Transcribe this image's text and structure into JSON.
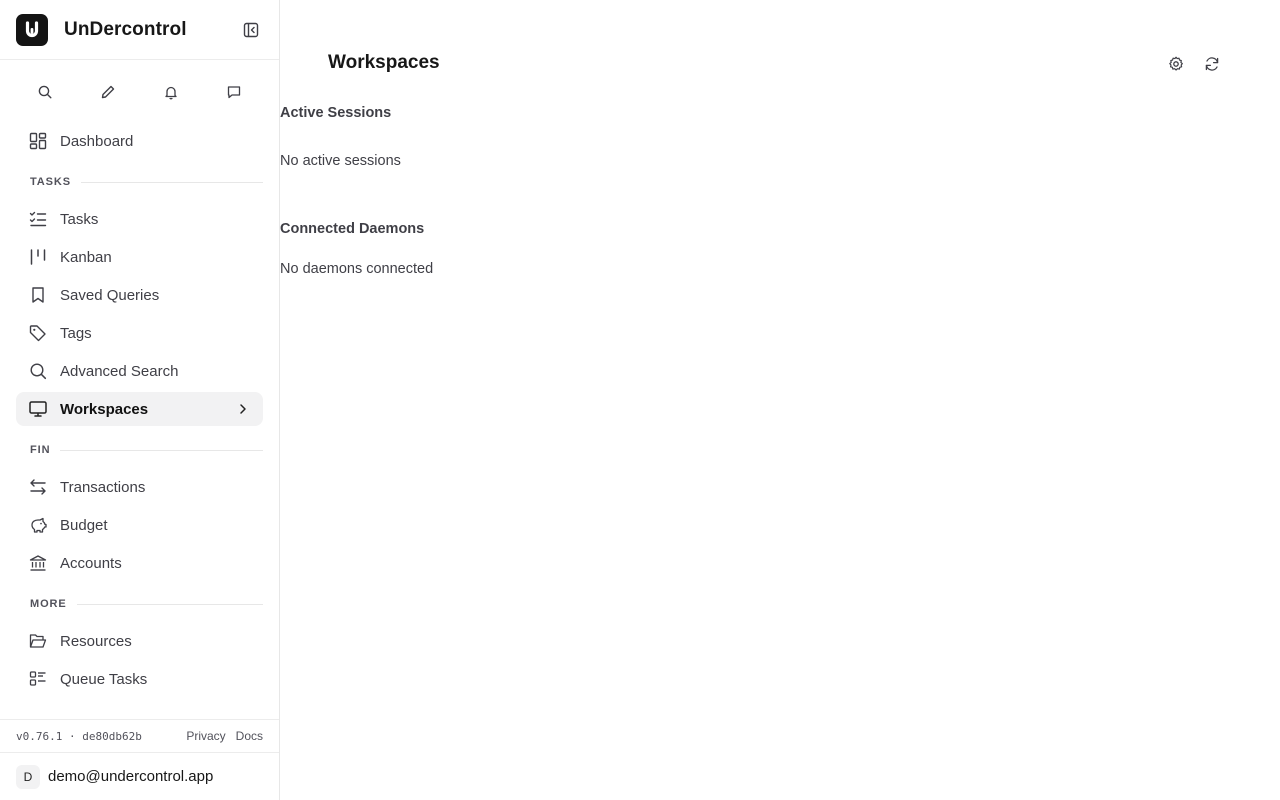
{
  "app": {
    "name": "UnDercontrol",
    "logo_letter": "U"
  },
  "quick_actions": [
    {
      "icon": "search-icon"
    },
    {
      "icon": "pencil-icon"
    },
    {
      "icon": "bell-icon"
    },
    {
      "icon": "message-icon"
    }
  ],
  "sidebar": {
    "dashboard": {
      "label": "Dashboard",
      "icon": "dashboard-icon"
    },
    "sections": {
      "tasks": "TASKS",
      "fin": "FIN",
      "more": "MORE"
    },
    "task_items": [
      {
        "label": "Tasks",
        "icon": "list-checks-icon"
      },
      {
        "label": "Kanban",
        "icon": "kanban-icon"
      },
      {
        "label": "Saved Queries",
        "icon": "bookmark-icon"
      },
      {
        "label": "Tags",
        "icon": "tag-icon"
      },
      {
        "label": "Advanced Search",
        "icon": "search-icon"
      },
      {
        "label": "Workspaces",
        "icon": "monitor-icon",
        "active": true
      }
    ],
    "fin_items": [
      {
        "label": "Transactions",
        "icon": "arrows-icon"
      },
      {
        "label": "Budget",
        "icon": "piggy-bank-icon"
      },
      {
        "label": "Accounts",
        "icon": "bank-icon"
      }
    ],
    "more_items": [
      {
        "label": "Resources",
        "icon": "folder-icon"
      },
      {
        "label": "Queue Tasks",
        "icon": "queue-icon"
      }
    ]
  },
  "footer": {
    "version": "v0.76.1 · de80db62b",
    "privacy": "Privacy",
    "docs": "Docs",
    "user_initial": "D",
    "user_email": "demo@undercontrol.app"
  },
  "main": {
    "title": "Workspaces",
    "active_sessions": {
      "heading": "Active Sessions",
      "empty": "No active sessions"
    },
    "connected_daemons": {
      "heading": "Connected Daemons",
      "empty": "No daemons connected"
    }
  },
  "colors": {
    "accent": "#141414",
    "active_bg": "#f2f2f3",
    "border": "#e7e7e7",
    "muted_text": "#3f3f46"
  }
}
